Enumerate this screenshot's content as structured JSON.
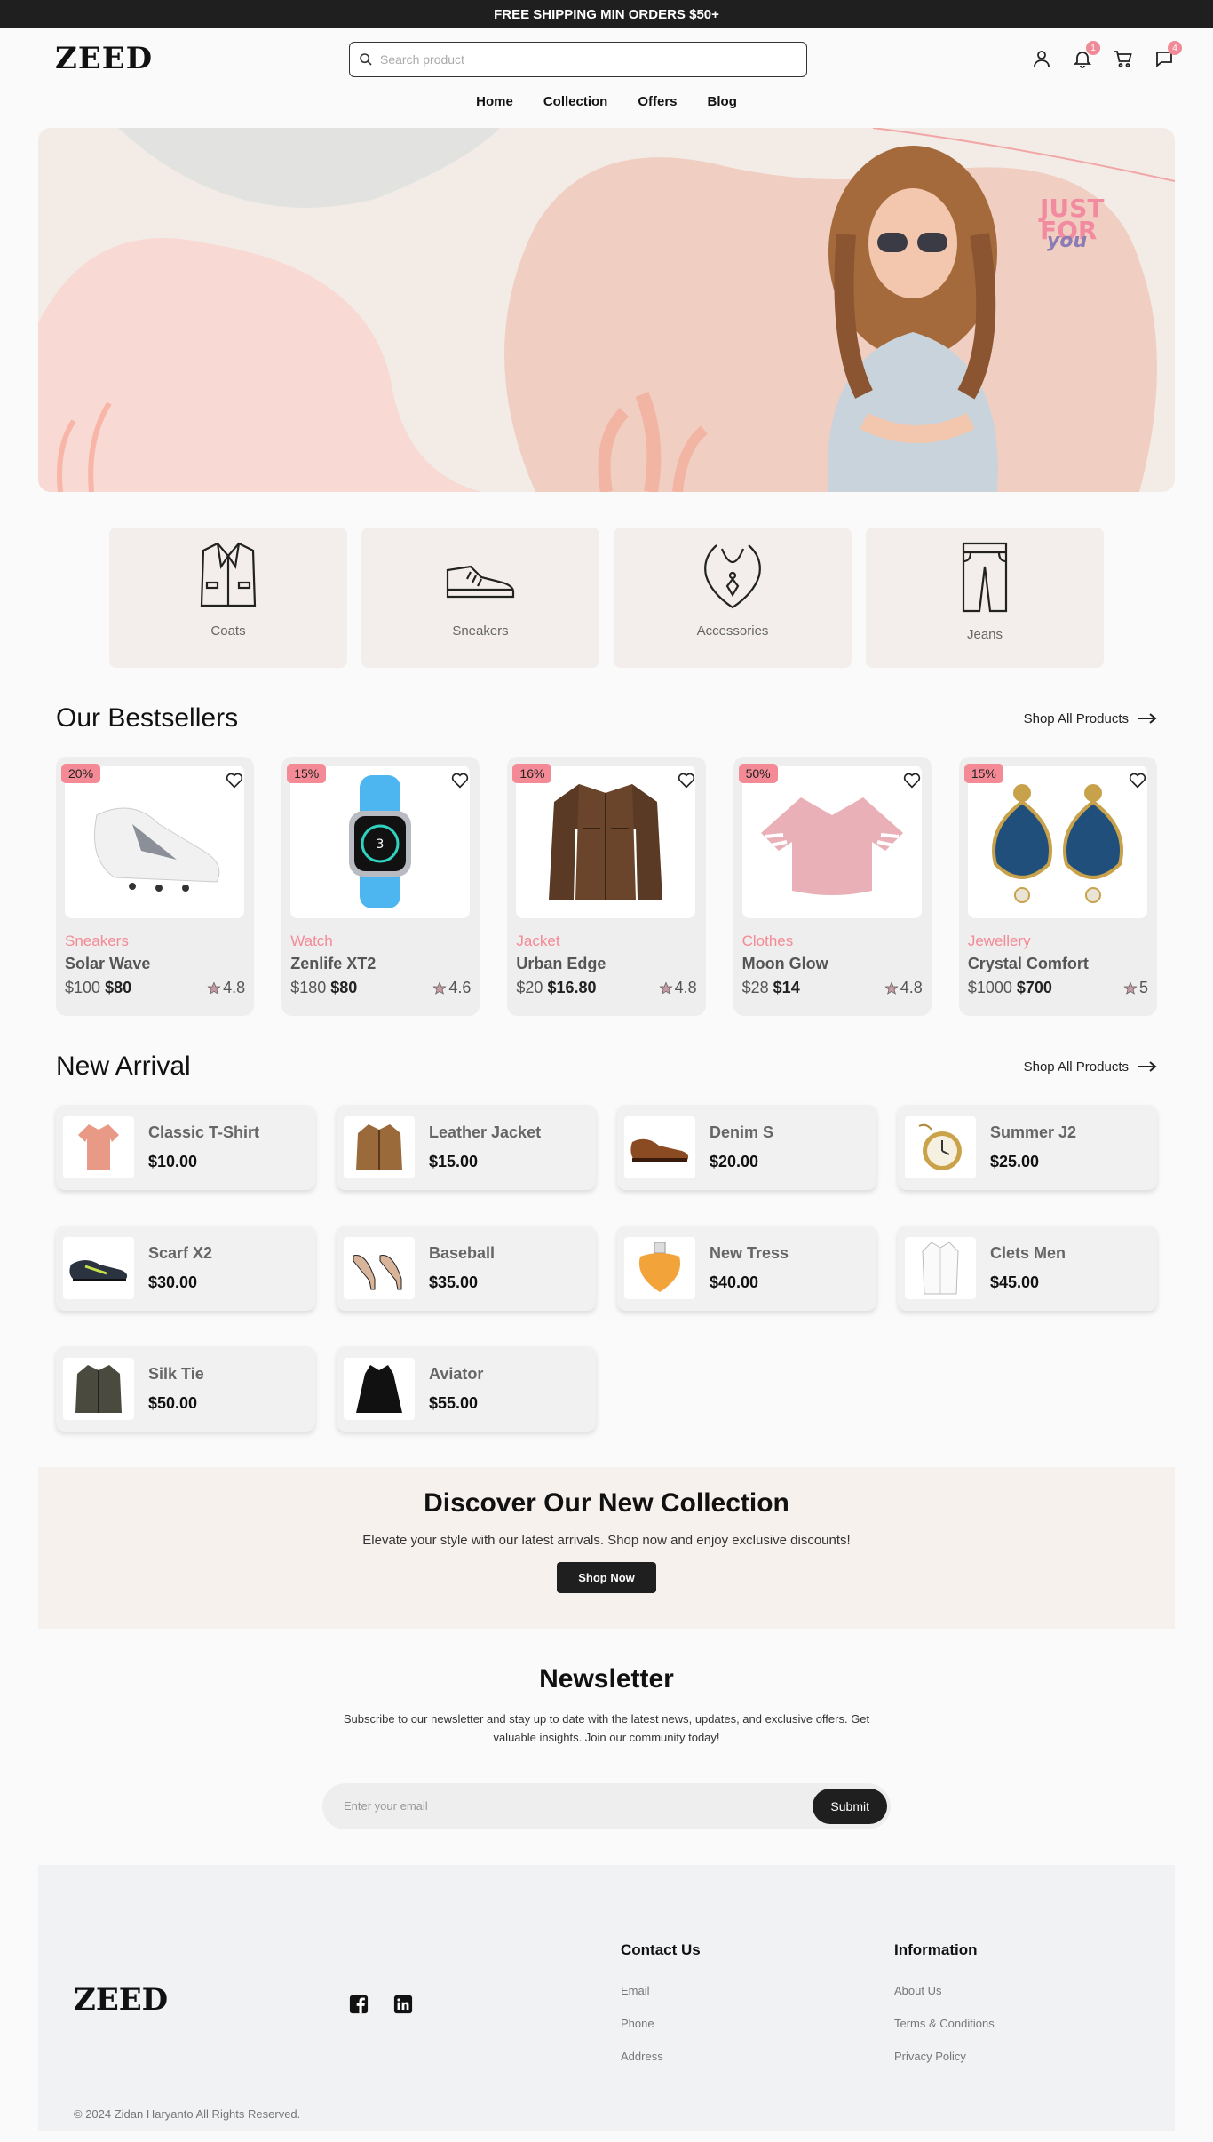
{
  "topbar": {
    "text": "FREE SHIPPING MIN ORDERS $50+"
  },
  "header": {
    "logo": "ZEED",
    "search_placeholder": "Search product",
    "icons": [
      "user-icon",
      "bell-icon",
      "cart-icon",
      "chat-icon"
    ],
    "bell_badge": "1",
    "chat_badge": "4"
  },
  "nav": [
    "Home",
    "Collection",
    "Offers",
    "Blog"
  ],
  "hero": {
    "tag_line1": "JUST",
    "tag_line2": "FOR",
    "tag_line3": "you"
  },
  "categories": [
    {
      "label": "Coats",
      "icon": "coat-icon"
    },
    {
      "label": "Sneakers",
      "icon": "sneaker-icon"
    },
    {
      "label": "Accessories",
      "icon": "necklace-icon"
    },
    {
      "label": "Jeans",
      "icon": "jeans-icon"
    }
  ],
  "bestsellers": {
    "title": "Our Bestsellers",
    "shop_all": "Shop All Products",
    "items": [
      {
        "discount": "20%",
        "category": "Sneakers",
        "name": "Solar Wave",
        "old_price": "$100",
        "price": "$80",
        "rating": "4.8"
      },
      {
        "discount": "15%",
        "category": "Watch",
        "name": "Zenlife XT2",
        "old_price": "$180",
        "price": "$80",
        "rating": "4.6"
      },
      {
        "discount": "16%",
        "category": "Jacket",
        "name": "Urban Edge",
        "old_price": "$20",
        "price": "$16.80",
        "rating": "4.8"
      },
      {
        "discount": "50%",
        "category": "Clothes",
        "name": "Moon Glow",
        "old_price": "$28",
        "price": "$14",
        "rating": "4.8"
      },
      {
        "discount": "15%",
        "category": "Jewellery",
        "name": "Crystal Comfort",
        "old_price": "$1000",
        "price": "$700",
        "rating": "5"
      }
    ]
  },
  "new_arrival": {
    "title": "New Arrival",
    "shop_all": "Shop All Products",
    "items": [
      {
        "name": "Classic T-Shirt",
        "price": "$10.00"
      },
      {
        "name": "Leather Jacket",
        "price": "$15.00"
      },
      {
        "name": "Denim S",
        "price": "$20.00"
      },
      {
        "name": "Summer J2",
        "price": "$25.00"
      },
      {
        "name": "Scarf X2",
        "price": "$30.00"
      },
      {
        "name": "Baseball",
        "price": "$35.00"
      },
      {
        "name": "New Tress",
        "price": "$40.00"
      },
      {
        "name": "Clets Men",
        "price": "$45.00"
      },
      {
        "name": "Silk Tie",
        "price": "$50.00"
      },
      {
        "name": "Aviator",
        "price": "$55.00"
      }
    ]
  },
  "discover": {
    "title": "Discover Our New Collection",
    "text": "Elevate your style with our latest arrivals. Shop now and enjoy exclusive discounts!",
    "button": "Shop Now"
  },
  "newsletter": {
    "title": "Newsletter",
    "text": "Subscribe to our newsletter and stay up to date with the latest news, updates, and exclusive offers. Get valuable insights. Join our community today!",
    "placeholder": "Enter your email",
    "button": "Submit"
  },
  "footer": {
    "logo": "ZEED",
    "social": [
      "facebook-icon",
      "linkedin-icon"
    ],
    "contact": {
      "title": "Contact Us",
      "links": [
        "Email",
        "Phone",
        "Address"
      ]
    },
    "info": {
      "title": "Information",
      "links": [
        "About Us",
        "Terms & Conditions",
        "Privacy Policy"
      ]
    },
    "copyright": "© 2024 Zidan Haryanto All Rights Reserved."
  },
  "colors": {
    "accent": "#f48a96",
    "dark": "#1f1f1f",
    "hero_bg": "#f3ece6"
  }
}
